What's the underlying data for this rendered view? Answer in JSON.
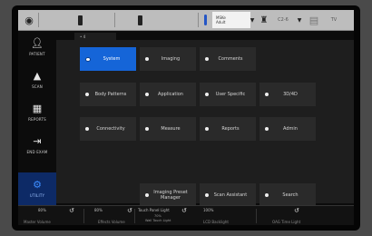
{
  "topbar": {
    "preset_line1": "MSKe",
    "preset_line2": "Adult",
    "probe_label": "C2-6",
    "extra_label": "TV"
  },
  "sidebar": {
    "items": [
      {
        "label": "PATIENT",
        "icon": "patient-icon"
      },
      {
        "label": "SCAN",
        "icon": "scan-icon"
      },
      {
        "label": "REPORTS",
        "icon": "reports-icon"
      },
      {
        "label": "END EXAM",
        "icon": "end-exam-icon"
      },
      {
        "label": "UTILITY",
        "icon": "utility-gear-icon",
        "active": true
      }
    ]
  },
  "tab": {
    "label": "• 4"
  },
  "buttons": [
    {
      "label": "System",
      "active": true
    },
    {
      "label": "Imaging"
    },
    {
      "label": "Comments"
    },
    {
      "label": "Body Patterns"
    },
    {
      "label": "Application"
    },
    {
      "label": "User Specific"
    },
    {
      "label": "3D/4D"
    },
    {
      "label": "Connectivity"
    },
    {
      "label": "Measure"
    },
    {
      "label": "Reports"
    },
    {
      "label": "Admin"
    },
    {
      "label": "Imaging Preset Manager"
    },
    {
      "label": "Scan Assistant"
    },
    {
      "label": "Search"
    }
  ],
  "bottombar": {
    "items": [
      {
        "value": "80%",
        "label": "Master Volume"
      },
      {
        "value": "80%",
        "label": "Effects Volume"
      },
      {
        "value": "Touch Panel Light",
        "label": "",
        "sub1": "70%",
        "sub2": "Wall Touch Light"
      },
      {
        "value": "100%",
        "label": "LCD Backlight"
      },
      {
        "value": "",
        "label": "OAG Time Light"
      }
    ]
  },
  "colors": {
    "accent": "#1565d8",
    "sidebar_active": "#0d2a66",
    "topbar": "#bdbdbd"
  }
}
